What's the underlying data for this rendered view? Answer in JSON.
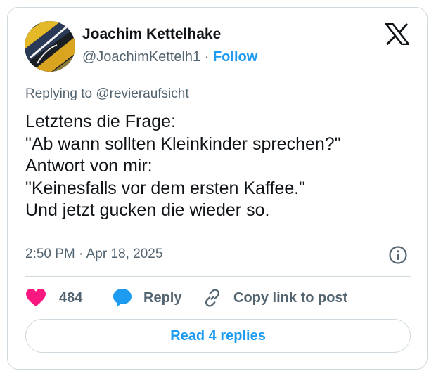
{
  "author": {
    "name": "Joachim Kettelhake",
    "handle": "@JoachimKettelh1",
    "separator": "·",
    "follow_label": "Follow"
  },
  "reply_context": {
    "prefix": "Replying to",
    "mention": "@revieraufsicht"
  },
  "tweet": {
    "lines": [
      "Letztens die Frage:",
      "\"Ab wann sollten Kleinkinder sprechen?\"",
      "Antwort von mir:",
      "\"Keinesfalls vor dem ersten Kaffee.\"",
      "Und jetzt gucken die wieder so."
    ],
    "timestamp": "2:50 PM · Apr 18, 2025"
  },
  "actions": {
    "like_count": "484",
    "reply_label": "Reply",
    "copy_label": "Copy link to post"
  },
  "read_replies_label": "Read 4 replies",
  "icons": {
    "logo": "x-logo-icon",
    "like": "heart-icon",
    "reply": "speech-bubble-icon",
    "copy": "link-icon",
    "info": "info-icon"
  },
  "colors": {
    "accent": "#1d9bf0",
    "like": "#f91880",
    "text_primary": "#0f1419",
    "text_secondary": "#536471",
    "border": "#cfd9de"
  }
}
